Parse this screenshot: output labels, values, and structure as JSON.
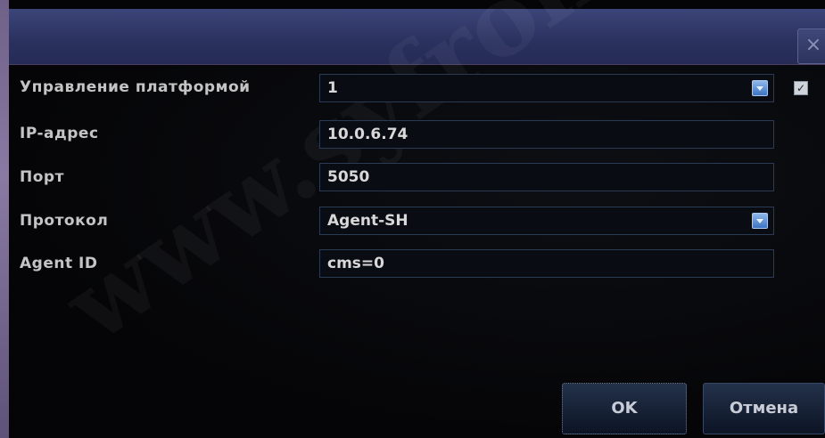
{
  "dialog": {
    "title": "",
    "close_glyph": "×"
  },
  "form": {
    "platform_label": "Управление платформой",
    "platform_value": "1",
    "platform_enabled": true,
    "ip_label": "IP-адрес",
    "ip_value": "10.0.6.74",
    "port_label": "Порт",
    "port_value": "5050",
    "protocol_label": "Протокол",
    "protocol_value": "Agent-SH",
    "agent_id_label": "Agent ID",
    "agent_id_value": "cms=0"
  },
  "buttons": {
    "ok_label": "OK",
    "cancel_label": "Отмена"
  },
  "watermark": {
    "text": "www.syfron.ru"
  },
  "colors": {
    "accent": "#4a7fd0",
    "titlebar": "#2f3766",
    "background": "#050507"
  }
}
